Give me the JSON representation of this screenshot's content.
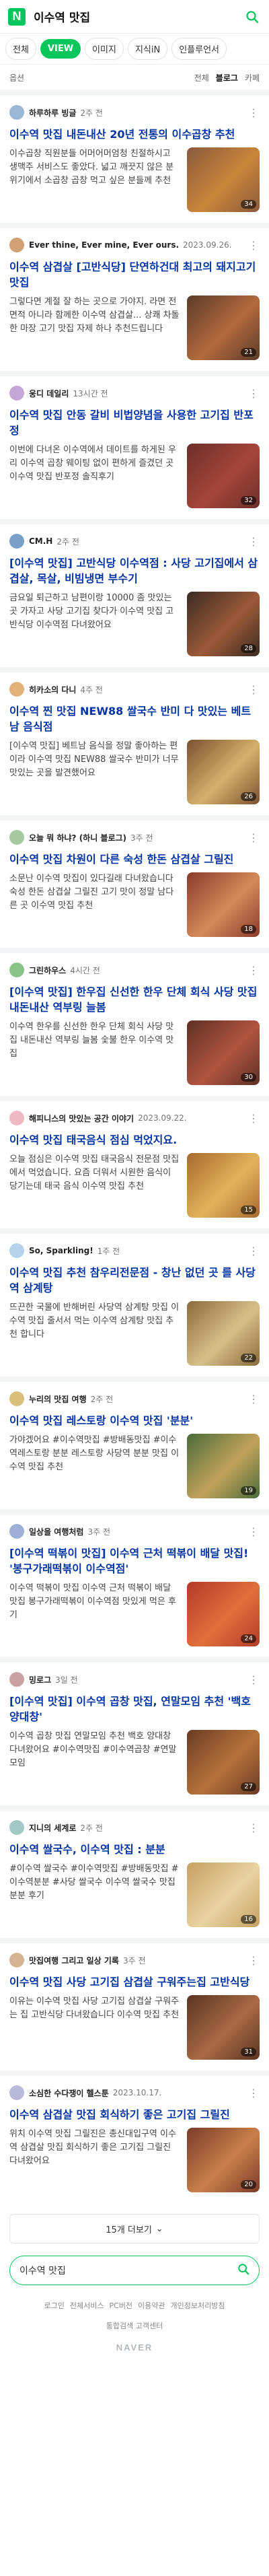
{
  "header": {
    "logo_letter": "N",
    "query": "이수역 맛집"
  },
  "tabs": [
    {
      "label": "전체",
      "active": false
    },
    {
      "label": "VIEW",
      "active": true
    },
    {
      "label": "이미지",
      "active": false
    },
    {
      "label": "지식iN",
      "active": false
    },
    {
      "label": "인플루언서",
      "active": false
    }
  ],
  "options": {
    "left": "옵션",
    "all": "전체",
    "blog": "블로그",
    "cafe": "카페"
  },
  "posts": [
    {
      "author": "하루하루 빙글",
      "date": "2주 전",
      "title": "이수역 맛집 내돈내산 20년 전통의 이수곱창 추천",
      "snippet": "이수곱창 직원분들 어머어머엄청 친절하시고 생맥주 서비스도 좋았다. 넓고 깨끗지 않은 분위기에서 소곱창 곱창 먹고 싶은 분들께 추천",
      "count": "34",
      "avatar_color": "#9bb7d4",
      "thumb_color": "#8a5a3b",
      "thumb_color2": "#c9863a"
    },
    {
      "author": "Ever thine, Ever mine, Ever ours.",
      "date": "2023.09.26.",
      "title": "이수역 삼겹살 [고반식당] 단연하건대 최고의 돼지고기 맛집",
      "snippet": "그렇다면 계절 잘 하는 곳으로 가야지. 라면 전면적 아니라 함께한 이수역 삼겹살... 상쾌 차돌한 마장 고기 맛집 자제 하나 추천드립니다",
      "count": "21",
      "avatar_color": "#d1a075",
      "thumb_color": "#5b3b2a",
      "thumb_color2": "#b36a3d"
    },
    {
      "author": "웅디 데일리",
      "date": "13시간 전",
      "title": "이수역 맛집 안동 갈비 비법양념을 사용한 고기집 반포정",
      "snippet": "이번에 다녀온 이수역에서 데이트를 하게된 우리 이수역 곱창 웨이팅 없이 편하게 즐겼던 곳 이수역 맛집 반포정 솔직후기",
      "count": "32",
      "avatar_color": "#c4a6d8",
      "thumb_color": "#6b2e2a",
      "thumb_color2": "#a5453a"
    },
    {
      "author": "CM.H",
      "date": "2주 전",
      "title": "[이수역 맛집] 고반식당 이수역점 : 사당 고기집에서 삼겹살, 목살, 비빔냉면 부수기",
      "snippet": "금요일 퇴근하고 남편이랑 10000 좀 맛있는 곳 가자고 사당 고기집 찾다가 이수역 맛집 고반식당 이수역점 다녀왔어요",
      "count": "28",
      "avatar_color": "#7aa0c9",
      "thumb_color": "#3b2a22",
      "thumb_color2": "#9c5a38"
    },
    {
      "author": "히카소의 다니",
      "date": "4주 전",
      "title": "이수역 찐 맛집 NEW88 쌀국수 반미 다 맛있는 베트남 음식점",
      "snippet": "[이수역 맛집] 베트남 음식을 정말 좋아하는 편이라 이수역 맛집 NEW88 쌀국수 반미가 너무 맛있는 곳을 발견했어요",
      "count": "26",
      "avatar_color": "#e3b17a",
      "thumb_color": "#7a5130",
      "thumb_color2": "#d6b06a"
    },
    {
      "author": "오늘 뭐 하냐? (하니 블로그)",
      "date": "3주 전",
      "title": "이수역 맛집 차원이 다른 숙성 한돈 삼겹살 그릴진",
      "snippet": "소문난 이수역 맛집이 있다길래 다녀왔습니다 숙성 한돈 삼겹살 그릴진 고기 맛이 정말 남다른 곳 이수역 맛집 추천",
      "count": "18",
      "avatar_color": "#a7c9a0",
      "thumb_color": "#8c3a2a",
      "thumb_color2": "#d38a5a"
    },
    {
      "author": "그린하우스",
      "date": "4시간 전",
      "title": "[이수역 맛집] 한우집 신선한 한우 단체 회식 사당 맛집 내돈내산 역부링 늘봄",
      "snippet": "이수역 한우를 신선한 한우 단체 회식 사당 맛집 내돈내산 역부링 늘봄 숯불 한우 이수역 맛집",
      "count": "30",
      "avatar_color": "#8bc48a",
      "thumb_color": "#5e2f25",
      "thumb_color2": "#b0553f"
    },
    {
      "author": "해피니스의 맛있는 공간 이야기",
      "date": "2023.09.22.",
      "title": "이수역 맛집 태국음식 점심 먹었지요.",
      "snippet": "오늘 점심은 이수역 맛집 태국음식 전문점 맛집에서 먹었습니다. 요즘 더워서 시원한 음식이 당기는데 태국 음식 이수역 맛집 추천",
      "count": "15",
      "avatar_color": "#f0b8c2",
      "thumb_color": "#a66a2e",
      "thumb_color2": "#e2b35b"
    },
    {
      "author": "So, Sparkling!",
      "date": "1주 전",
      "title": "이수역 맛집 추천 참우리전문점 - 창난 없던 곳 를 사당역 삼계탕",
      "snippet": "뜨끈한 국물에 반해버린 사당역 삼계탕 맛집 이수역 맛집 줄서서 먹는 이수역 삼계탕 맛집 추천 합니다",
      "count": "22",
      "avatar_color": "#b7d3ec",
      "thumb_color": "#8a6a3a",
      "thumb_color2": "#d8c08a"
    },
    {
      "author": "누리의 맛집 여행",
      "date": "2주 전",
      "title": "이수역 맛집 레스토랑 이수역 맛집 '분분'",
      "snippet": "가야겠어요 #이수역맛집 #방배동맛집 #이수역레스토랑 분분 레스토랑 사당역 분분 맛집 이수역 맛집 추천",
      "count": "19",
      "avatar_color": "#d8c07a",
      "thumb_color": "#4a6b3a",
      "thumb_color2": "#c2a25a"
    },
    {
      "author": "일상을 여행처럼",
      "date": "3주 전",
      "title": "[이수역 떡볶이 맛집] 이수역 근처 떡볶이 배달 맛집! '봉구가래떡볶이 이수역점'",
      "snippet": "이수역 떡볶이 맛집 이수역 근처 떡볶이 배달 맛집 봉구가래떡볶이 이수역점 맛있게 먹은 후기",
      "count": "24",
      "avatar_color": "#9fb0d8",
      "thumb_color": "#b33a2a",
      "thumb_color2": "#e0703a"
    },
    {
      "author": "밍로그",
      "date": "3일 전",
      "title": "[이수역 맛집] 이수역 곱창 맛집, 연말모임 추천 '백호 양대창'",
      "snippet": "이수역 곱창 맛집 연말모임 추천 백호 양대창 다녀왔어요 #이수역맛집 #이수역곱창 #연말모임",
      "count": "27",
      "avatar_color": "#c9a3a3",
      "thumb_color": "#6b3a24",
      "thumb_color2": "#b5733a"
    },
    {
      "author": "지니의 세계로",
      "date": "2주 전",
      "title": "이수역 쌀국수, 이수역 맛집 : 분분",
      "snippet": "#이수역 쌀국수 #이수역맛집 #방배동맛집 #이수역분분 #사당 쌀국수 이수역 쌀국수 맛집 분분 후기",
      "count": "16",
      "avatar_color": "#a3c9c4",
      "thumb_color": "#c7a064",
      "thumb_color2": "#e8d3a1"
    },
    {
      "author": "맛집여행 그리고 일상 기록",
      "date": "3주 전",
      "title": "이수역 맛집 사당 고기집 삼겹살 구워주는집 고반식당",
      "snippet": "이유는 이수역 맛집 사당 고기집 삼겹살 구워주는 집 고반식당 다녀왔습니다 이수역 맛집 추천",
      "count": "31",
      "avatar_color": "#d4b593",
      "thumb_color": "#5a3422",
      "thumb_color2": "#a96a43"
    },
    {
      "author": "소심한 수다쟁이 헬스툰",
      "date": "2023.10.17.",
      "title": "이수역 삼겹살 맛집 회식하기 좋은 고기집 그릴진",
      "snippet": "위치 이수역 맛집 그릴진은 총신대입구역 이수역 삼겹살 맛집 회식하기 좋은 고기집 그릴진 다녀왔어요",
      "count": "20",
      "avatar_color": "#b9b9d9",
      "thumb_color": "#7a3b2a",
      "thumb_color2": "#c9804a"
    }
  ],
  "more_button": "15개 더보기",
  "footer": {
    "search_text": "이수역 맛집",
    "links": [
      "로그인",
      "전체서비스",
      "PC버전",
      "이용약관",
      "개인정보처리방침",
      "통합검색 고객센터"
    ],
    "brand": "NAVER"
  }
}
